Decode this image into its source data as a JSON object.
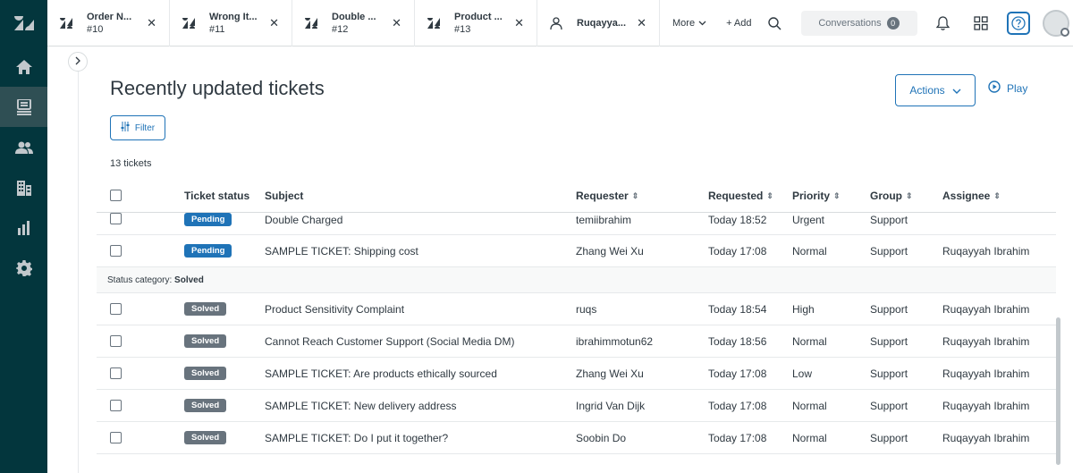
{
  "tabs": [
    {
      "title": "Order N...",
      "sub": "#10"
    },
    {
      "title": "Wrong It...",
      "sub": "#11"
    },
    {
      "title": "Double ...",
      "sub": "#12"
    },
    {
      "title": "Product ...",
      "sub": "#13"
    },
    {
      "title": "Ruqayya...",
      "sub": ""
    }
  ],
  "topbar": {
    "more_label": "More",
    "add_label": "+ Add",
    "conversations_label": "Conversations",
    "conversations_count": "0"
  },
  "page": {
    "title": "Recently updated tickets",
    "actions_label": "Actions",
    "play_label": "Play",
    "filter_label": "Filter",
    "ticket_count": "13 tickets"
  },
  "columns": {
    "status": "Ticket status",
    "subject": "Subject",
    "requester": "Requester",
    "requested": "Requested",
    "priority": "Priority",
    "group": "Group",
    "assignee": "Assignee"
  },
  "pending_rows": [
    {
      "status": "Pending",
      "subject": "Double Charged",
      "requester": "temiibrahim",
      "requested": "Today 18:52",
      "priority": "Urgent",
      "group": "Support",
      "assignee": ""
    },
    {
      "status": "Pending",
      "subject": "SAMPLE TICKET: Shipping cost",
      "requester": "Zhang Wei Xu",
      "requested": "Today 17:08",
      "priority": "Normal",
      "group": "Support",
      "assignee": "Ruqayyah Ibrahim"
    }
  ],
  "group_label": {
    "prefix": "Status category: ",
    "value": "Solved"
  },
  "solved_rows": [
    {
      "status": "Solved",
      "subject": "Product Sensitivity Complaint",
      "requester": "ruqs",
      "requested": "Today 18:54",
      "priority": "High",
      "group": "Support",
      "assignee": "Ruqayyah Ibrahim"
    },
    {
      "status": "Solved",
      "subject": "Cannot Reach Customer Support (Social Media DM)",
      "requester": "ibrahimmotun62",
      "requested": "Today 18:56",
      "priority": "Normal",
      "group": "Support",
      "assignee": "Ruqayyah Ibrahim"
    },
    {
      "status": "Solved",
      "subject": "SAMPLE TICKET: Are products ethically sourced",
      "requester": "Zhang Wei Xu",
      "requested": "Today 17:08",
      "priority": "Low",
      "group": "Support",
      "assignee": "Ruqayyah Ibrahim"
    },
    {
      "status": "Solved",
      "subject": "SAMPLE TICKET: New delivery address",
      "requester": "Ingrid Van Dijk",
      "requested": "Today 17:08",
      "priority": "Normal",
      "group": "Support",
      "assignee": "Ruqayyah Ibrahim"
    },
    {
      "status": "Solved",
      "subject": "SAMPLE TICKET: Do I put it together?",
      "requester": "Soobin Do",
      "requested": "Today 17:08",
      "priority": "Normal",
      "group": "Support",
      "assignee": "Ruqayyah Ibrahim"
    }
  ]
}
